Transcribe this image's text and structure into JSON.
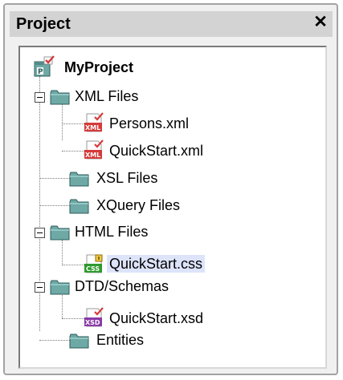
{
  "panel": {
    "title": "Project",
    "close_glyph": "✕"
  },
  "tree": {
    "root": {
      "label": "MyProject",
      "icon": "project-icon"
    },
    "items": [
      {
        "label": "XML Files",
        "icon": "folder-icon",
        "expanded": true
      },
      {
        "label": "Persons.xml",
        "icon": "xml-file-icon"
      },
      {
        "label": "QuickStart.xml",
        "icon": "xml-file-icon"
      },
      {
        "label": "XSL Files",
        "icon": "folder-icon"
      },
      {
        "label": "XQuery Files",
        "icon": "folder-icon"
      },
      {
        "label": "HTML Files",
        "icon": "folder-icon",
        "expanded": true
      },
      {
        "label": "QuickStart.css",
        "icon": "css-file-icon",
        "selected": true
      },
      {
        "label": "DTD/Schemas",
        "icon": "folder-icon",
        "expanded": true
      },
      {
        "label": "QuickStart.xsd",
        "icon": "xsd-file-icon"
      },
      {
        "label": "Entities",
        "icon": "folder-icon"
      }
    ]
  },
  "colors": {
    "selection": "#dde4fa",
    "folder": "#6ea9a6",
    "xml_badge": "#d63a3a",
    "css_badge": "#2e9a2e",
    "xsd_badge": "#8a3aa8",
    "titlebar": "#d3d3d3"
  }
}
